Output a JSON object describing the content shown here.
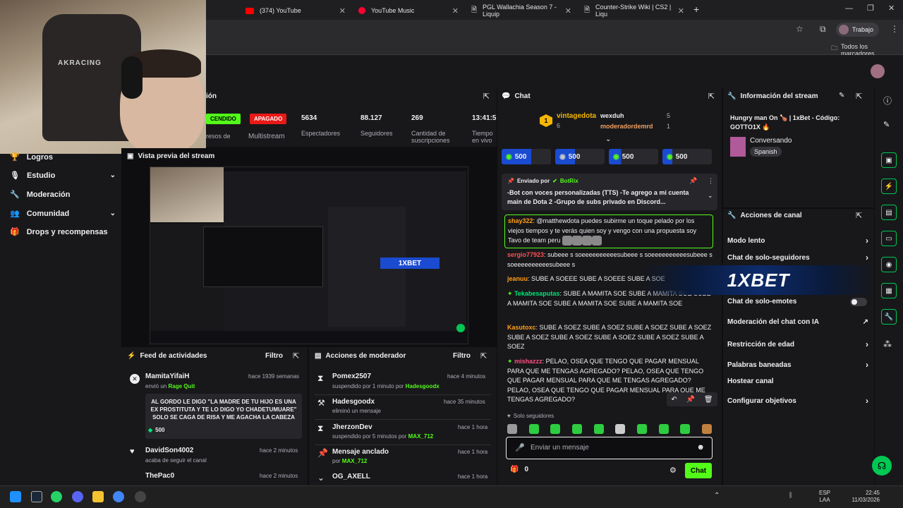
{
  "browser": {
    "tabs": [
      {
        "label": "(374) YouTube"
      },
      {
        "label": "YouTube Music"
      },
      {
        "label": "PGL Wallachia Season 7 - Liquip"
      },
      {
        "label": "Counter-Strike Wiki | CS2 | Liqu"
      }
    ],
    "profile": "Trabajo",
    "bookmarks_label": "Todos los marcadores"
  },
  "sidebar": {
    "items": [
      {
        "label": "Logros",
        "icon": "trophy-icon"
      },
      {
        "label": "Estudio",
        "icon": "studio-icon"
      },
      {
        "label": "Moderación",
        "icon": "wrench-icon"
      },
      {
        "label": "Comunidad",
        "icon": "community-icon"
      },
      {
        "label": "Drops y recompensas",
        "icon": "gift-icon"
      }
    ]
  },
  "stream_panel": {
    "title_fragment": "ión",
    "status_on": "CENDIDO",
    "status_off": "APAGADO",
    "ingresos": "resos de",
    "multistream": "Multistream",
    "viewers": "5634",
    "viewers_label": "Espectadores",
    "followers": "88.127",
    "followers_label": "Seguidores",
    "subs": "269",
    "subs_label": "Cantidad de suscripciones",
    "uptime": "13:41:5",
    "uptime_label": "Tiempo en vivo"
  },
  "preview": {
    "title": "Vista previa del stream",
    "overlay_logo": "1XBET"
  },
  "activity_feed": {
    "title": "Feed de actividades",
    "filter": "Filtro",
    "items": [
      {
        "user": "MamitaYifaiH",
        "time": "hace 1939 semanas",
        "text": "envió un",
        "extra": "Rage Quit"
      },
      {
        "user": "DavidSon4002",
        "time": "hace 2 minutos",
        "text": "acaba de seguir el canal"
      },
      {
        "user": "ThePac0",
        "time": "hace 2 minutos",
        "text": ""
      }
    ],
    "message": "AL GORDO LE DIGO \"LA MADRE DE TU HIJO ES UNA EX PROSTITUTA Y TE LO DIGO YO CHADETUMUARE\" SOLO SE CAGA DE RISA Y ME AGACHA LA CABEZA",
    "bits": "500"
  },
  "mod_actions": {
    "title": "Acciones de moderador",
    "filter": "Filtro",
    "items": [
      {
        "user": "Pomex2507",
        "time": "hace 4 minutos",
        "text": "suspendido por 1 minuto por",
        "by": "Hadesgoodx"
      },
      {
        "user": "Hadesgoodx",
        "time": "hace 35 minutos",
        "text": "eliminó un mensaje",
        "by": ""
      },
      {
        "user": "JherzonDev",
        "time": "hace 1 hora",
        "text": "suspendido por 5 minutos por",
        "by": "MAX_712"
      },
      {
        "user": "Mensaje anclado",
        "time": "hace 1 hora",
        "text": "por",
        "by": "MAX_712"
      },
      {
        "user": "OG_AXELL",
        "time": "hace 1 hora",
        "text": "",
        "by": ""
      }
    ]
  },
  "chat": {
    "title": "Chat",
    "leaderboard": {
      "rank1": "1",
      "user1": "vintagedota",
      "score1": "6",
      "user2": "wexduh",
      "score2": "5",
      "user3": "moderadordemrd",
      "score3": "1"
    },
    "gift_values": [
      "500",
      "500",
      "500",
      "500"
    ],
    "pinned": {
      "sent_by": "Enviado por",
      "bot": "BotRix",
      "text": "-Bot con voces personalizadas (TTS) -Te agrego a mi cuenta main de Dota 2 -Grupo de subs privado en Discord..."
    },
    "messages": [
      {
        "user": "shay322",
        "color": "#ff9f1a",
        "text": "@matthewdota puedes subirme un toque pelado por los viejos tiempos y te verás quien soy y vengo con una propuesta soy Tavo de team peru"
      },
      {
        "user": "sergio77923",
        "color": "#ff4f4f",
        "text": "subeee s soeeeeeeeeeesubeee s soeeeeeeeeeesubeee s soeeeeeeeeeesubeee s"
      },
      {
        "user": "jeanuu",
        "color": "#ff9f1a",
        "text": "SUBE A SOEEE SUBE A SOEEE SUBE A SOE"
      },
      {
        "user": "Tekabesaputas",
        "color": "#00e676",
        "text": "SUBE A MAMITA SOE SUBE A MAMITA SOE SUBE A MAMITA SOE SUBE A MAMITA SOE SUBE A MAMITA SOE"
      },
      {
        "user": "Kasutoxc",
        "color": "#ff9f1a",
        "text": "SUBE A SOEZ SUBE A SOEZ SUBE A SOEZ SUBE A SOEZ SUBE A SOEZ SUBE A SOEZ SUBE A SOEZ SUBE A SOEZ SUBE A SOEZ"
      },
      {
        "user": "mishazzz",
        "color": "#ff4f7f",
        "text": "PELAO, OSEA QUE TENGO QUE PAGAR MENSUAL PARA QUE ME TENGAS AGREGADO? PELAO, OSEA QUE TENGO QUE PAGAR MENSUAL PARA QUE ME TENGAS AGREGADO? PELAO, OSEA QUE TENGO QUE PAGAR MENSUAL PARA QUE ME TENGAS AGREGADO?"
      }
    ],
    "followers_only": "Solo seguidores",
    "input_placeholder": "Enviar un mensaje",
    "points": "0",
    "send_label": "Chat"
  },
  "stream_info": {
    "title": "Información del stream",
    "stream_title": "Hungry man On 🍗 | 1xBet - Código: GOTTO1X 🔥",
    "category": "Conversando",
    "language": "Spanish"
  },
  "channel_actions": {
    "title": "Acciones de canal",
    "items": [
      {
        "label": "Modo lento"
      },
      {
        "label": "Chat de solo-seguidores"
      },
      {
        "label": "Chat de solo-emotes"
      },
      {
        "label": "Moderación del chat con IA"
      },
      {
        "label": "Restricción de edad"
      },
      {
        "label": "Palabras baneadas"
      },
      {
        "label": "Hostear canal"
      },
      {
        "label": "Configurar objetivos"
      }
    ]
  },
  "taskbar": {
    "lang1": "ESP",
    "lang2": "LAA",
    "time": "22:45",
    "date": "11/03/2026"
  },
  "colors": {
    "accent": "#00e676",
    "live_green": "#53fc18",
    "offline_red": "#e91916",
    "panel": "#18181b",
    "bg": "#0e0e10"
  }
}
